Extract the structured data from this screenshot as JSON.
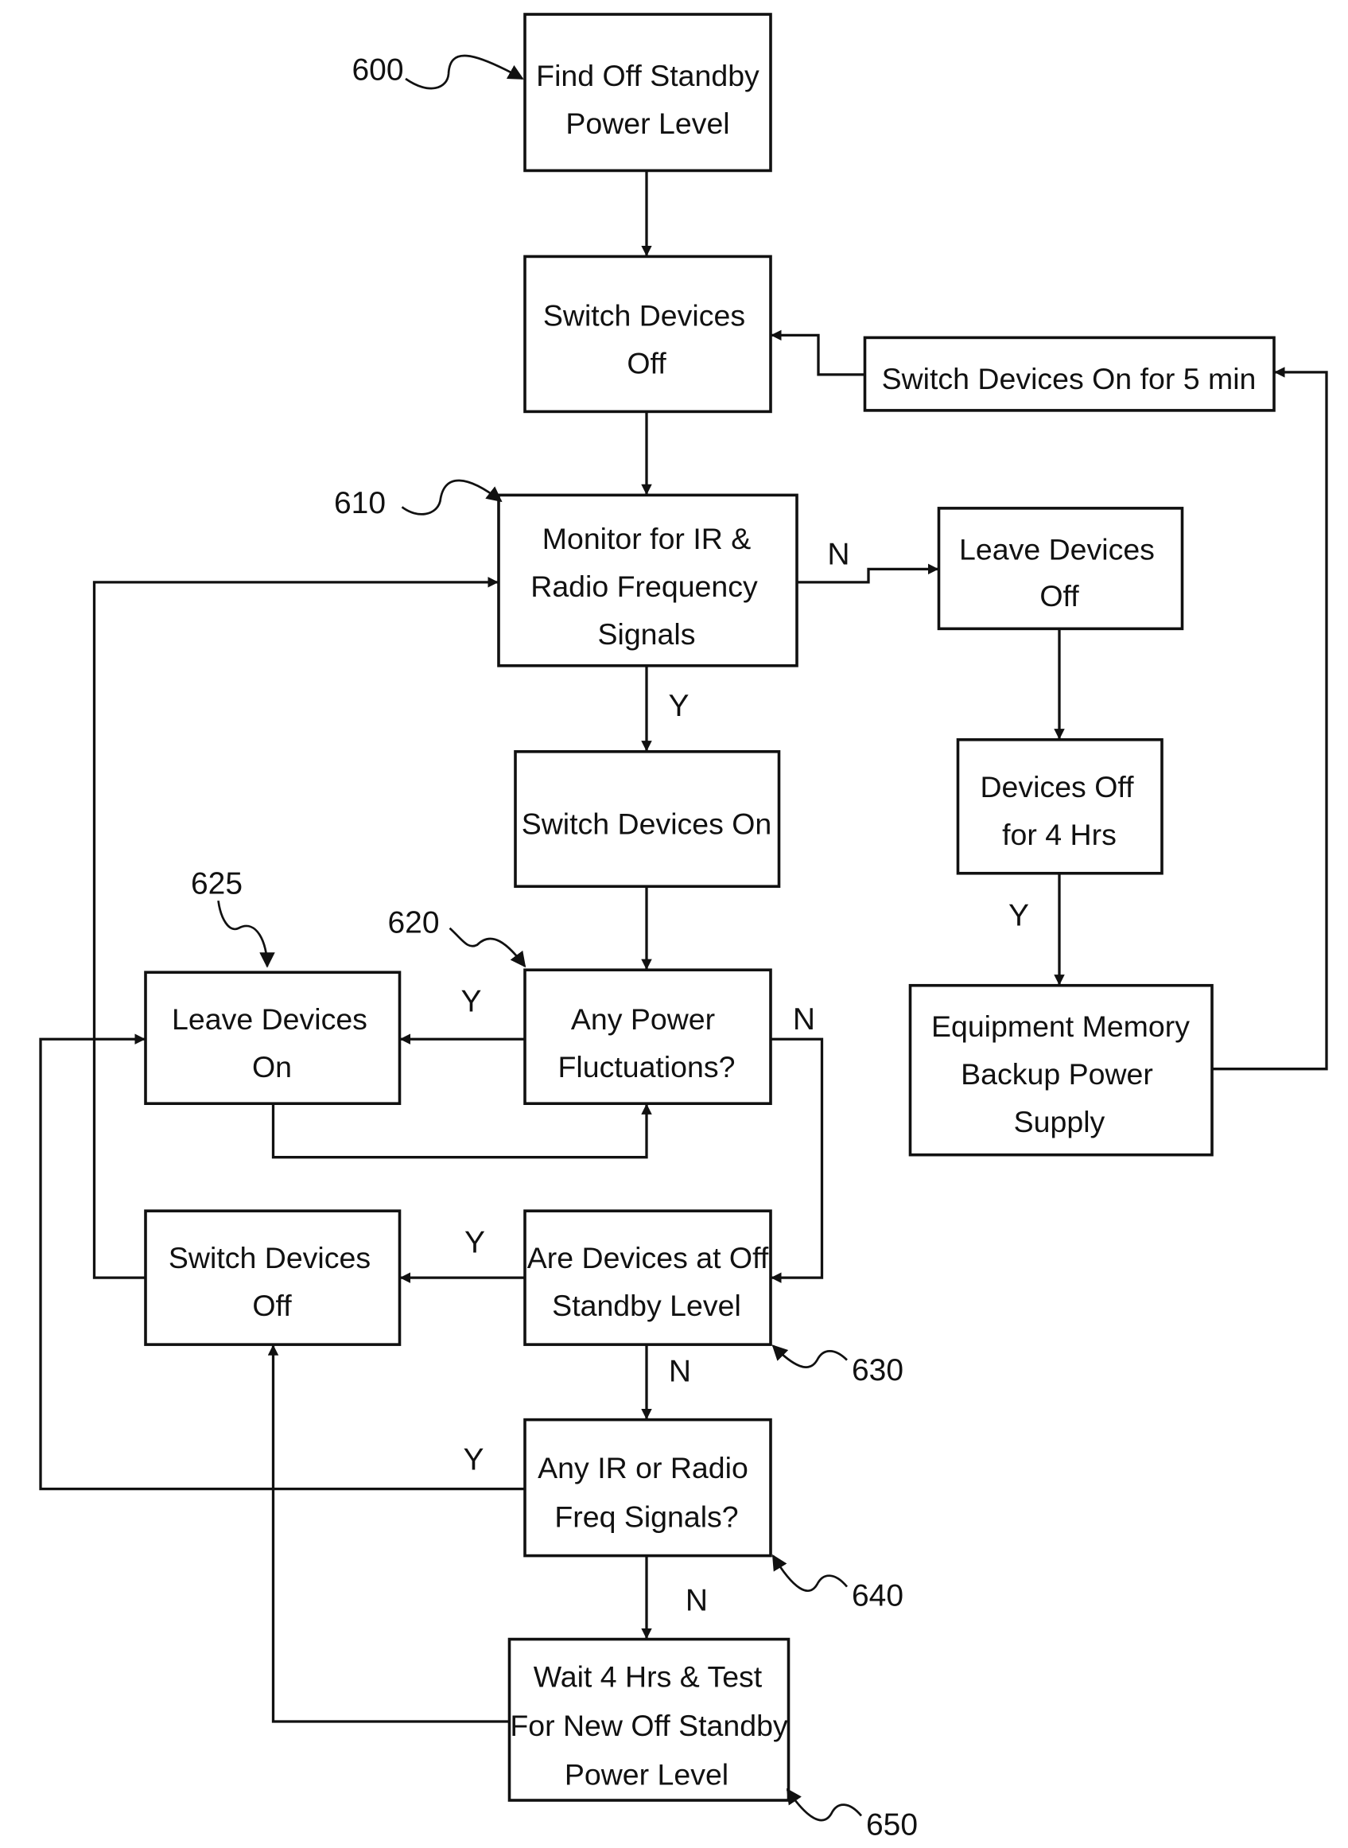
{
  "figure": {
    "nodes": {
      "find_standby": {
        "lines": [
          "Find Off Standby",
          "Power Level"
        ]
      },
      "switch_off_top": {
        "lines": [
          "Switch Devices",
          "Off"
        ]
      },
      "switch_on_5min": {
        "lines": [
          "Switch Devices On for 5 min"
        ]
      },
      "monitor": {
        "lines": [
          "Monitor for IR &",
          "Radio Frequency",
          "Signals"
        ]
      },
      "leave_off": {
        "lines": [
          "Leave Devices",
          "Off"
        ]
      },
      "switch_on": {
        "lines": [
          "Switch Devices On"
        ]
      },
      "off_4hrs": {
        "lines": [
          "Devices Off",
          "for 4 Hrs"
        ]
      },
      "leave_on": {
        "lines": [
          "Leave Devices",
          "On"
        ]
      },
      "power_fluct": {
        "lines": [
          "Any Power",
          "Fluctuations?"
        ]
      },
      "memory_backup": {
        "lines": [
          "Equipment Memory",
          "Backup Power",
          "Supply"
        ]
      },
      "switch_off_mid": {
        "lines": [
          "Switch Devices",
          "Off"
        ]
      },
      "at_standby": {
        "lines": [
          "Are Devices at Off",
          "Standby Level"
        ]
      },
      "any_ir": {
        "lines": [
          "Any IR or Radio",
          "Freq Signals?"
        ]
      },
      "wait_test": {
        "lines": [
          "Wait 4 Hrs & Test",
          "For New Off Standby",
          "Power Level"
        ]
      }
    },
    "edge_labels": {
      "monitor_no": "N",
      "monitor_yes": "Y",
      "off4_yes": "Y",
      "fluct_yes": "Y",
      "fluct_no": "N",
      "standby_yes": "Y",
      "standby_no": "N",
      "ir_yes": "Y",
      "ir_no": "N"
    },
    "reference_numerals": {
      "r600": "600",
      "r610": "610",
      "r620": "620",
      "r625": "625",
      "r630": "630",
      "r640": "640",
      "r650": "650"
    }
  }
}
